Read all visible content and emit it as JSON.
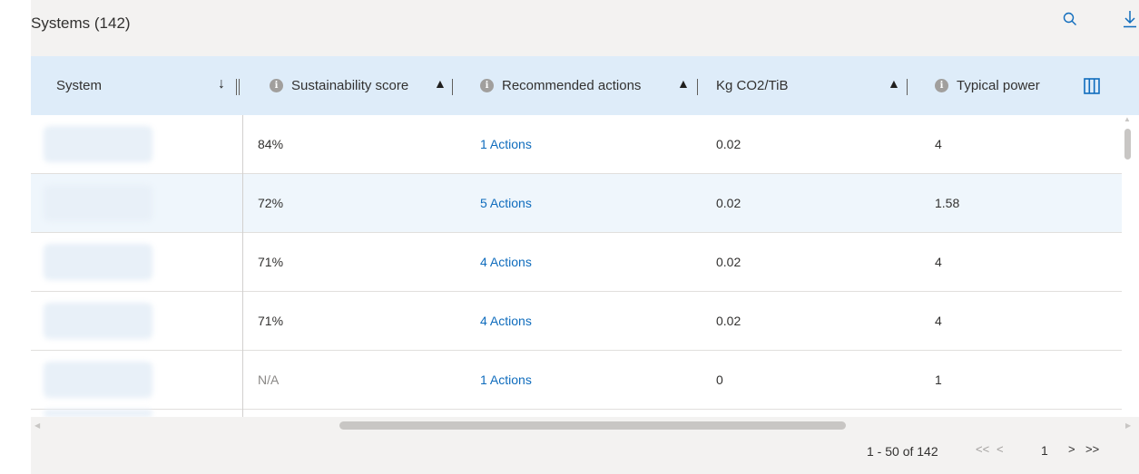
{
  "title": "Systems (142)",
  "toolbar": {
    "search_icon": "search-icon",
    "download_icon": "download-icon"
  },
  "columns": {
    "system": "System",
    "score": "Sustainability score",
    "actions": "Recommended actions",
    "co2": "Kg CO2/TiB",
    "power": "Typical power",
    "info_glyph": "i"
  },
  "rows": [
    {
      "score": "84%",
      "actions": "1 Actions",
      "co2": "0.02",
      "power": "4"
    },
    {
      "score": "72%",
      "actions": "5 Actions",
      "co2": "0.02",
      "power": "1.58"
    },
    {
      "score": "71%",
      "actions": "4 Actions",
      "co2": "0.02",
      "power": "4"
    },
    {
      "score": "71%",
      "actions": "4 Actions",
      "co2": "0.02",
      "power": "4"
    },
    {
      "score": "N/A",
      "actions": "1 Actions",
      "co2": "0",
      "power": "1"
    }
  ],
  "pagination": {
    "range": "1 - 50 of 142",
    "first": "<<",
    "prev": "<",
    "page": "1",
    "next": ">",
    "last": ">>"
  },
  "colors": {
    "accent": "#0f6cbd",
    "header_bg": "#deecf9",
    "selected_row": "#eff6fc"
  }
}
